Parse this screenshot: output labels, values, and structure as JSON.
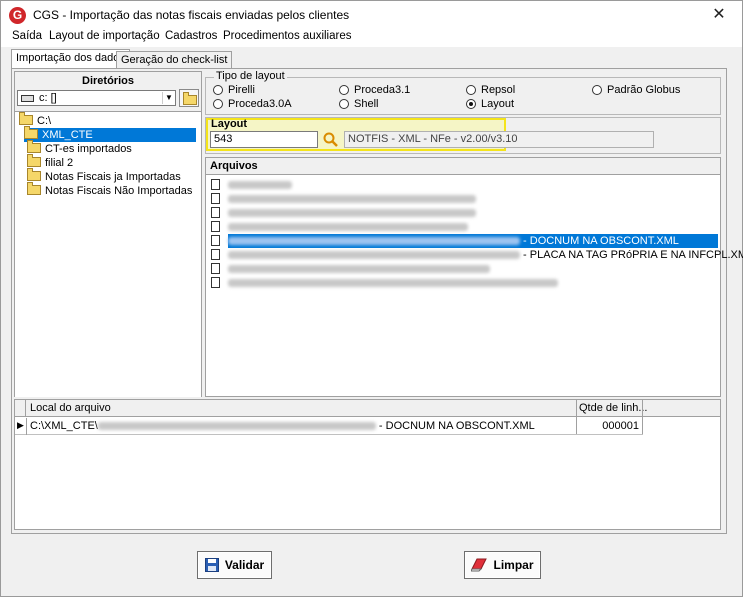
{
  "window": {
    "title": "CGS - Importação das notas fiscais enviadas pelos clientes",
    "app_icon_letter": "G"
  },
  "menu": [
    "Saída",
    "Layout de importação",
    "Cadastros",
    "Procedimentos auxiliares"
  ],
  "tabs": [
    {
      "label": "Importação dos dados",
      "active": true
    },
    {
      "label": "Geração do check-list",
      "active": false
    }
  ],
  "directories": {
    "header": "Diretórios",
    "drive": "c: []",
    "tree": [
      {
        "label": "C:\\",
        "level": 0,
        "selected": false
      },
      {
        "label": "XML_CTE",
        "level": 1,
        "selected": true
      },
      {
        "label": "CT-es importados",
        "level": 2,
        "selected": false
      },
      {
        "label": "filial 2",
        "level": 2,
        "selected": false
      },
      {
        "label": "Notas Fiscais ja Importadas",
        "level": 2,
        "selected": false
      },
      {
        "label": "Notas Fiscais Não Importadas",
        "level": 2,
        "selected": false
      }
    ]
  },
  "layout_type": {
    "legend": "Tipo de layout",
    "options": [
      {
        "label": "Pirelli",
        "checked": false
      },
      {
        "label": "Proceda3.1",
        "checked": false
      },
      {
        "label": "Repsol",
        "checked": false
      },
      {
        "label": "Padrão Globus",
        "checked": false
      },
      {
        "label": "Proceda3.0A",
        "checked": false
      },
      {
        "label": "Shell",
        "checked": false
      },
      {
        "label": "Layout",
        "checked": true
      }
    ]
  },
  "layout": {
    "header": "Layout",
    "code": "543",
    "description": "NOTFIS - XML - NFe - v2.00/v3.10"
  },
  "files": {
    "header": "Arquivos",
    "rows": [
      {
        "suffix": "",
        "selected": false
      },
      {
        "suffix": "",
        "selected": false
      },
      {
        "suffix": "",
        "selected": false
      },
      {
        "suffix": "",
        "selected": false
      },
      {
        "suffix": " - DOCNUM NA OBSCONT.XML",
        "selected": true
      },
      {
        "suffix": " - PLACA NA TAG PRóPRIA E NA INFCPL.XM",
        "selected": false
      },
      {
        "suffix": "",
        "selected": false
      },
      {
        "suffix": "",
        "selected": false
      }
    ]
  },
  "grid": {
    "columns": [
      "Local do arquivo",
      "Qtde de linh..."
    ],
    "rows": [
      {
        "path_prefix": "C:\\XML_CTE\\",
        "path_suffix": " - DOCNUM NA OBSCONT.XML",
        "qty": "000001"
      }
    ]
  },
  "buttons": {
    "validate": "Validar",
    "clear": "Limpar"
  },
  "colors": {
    "selection": "#0078d7",
    "highlight": "#f4e41a",
    "search_icon": "#d98c00"
  }
}
